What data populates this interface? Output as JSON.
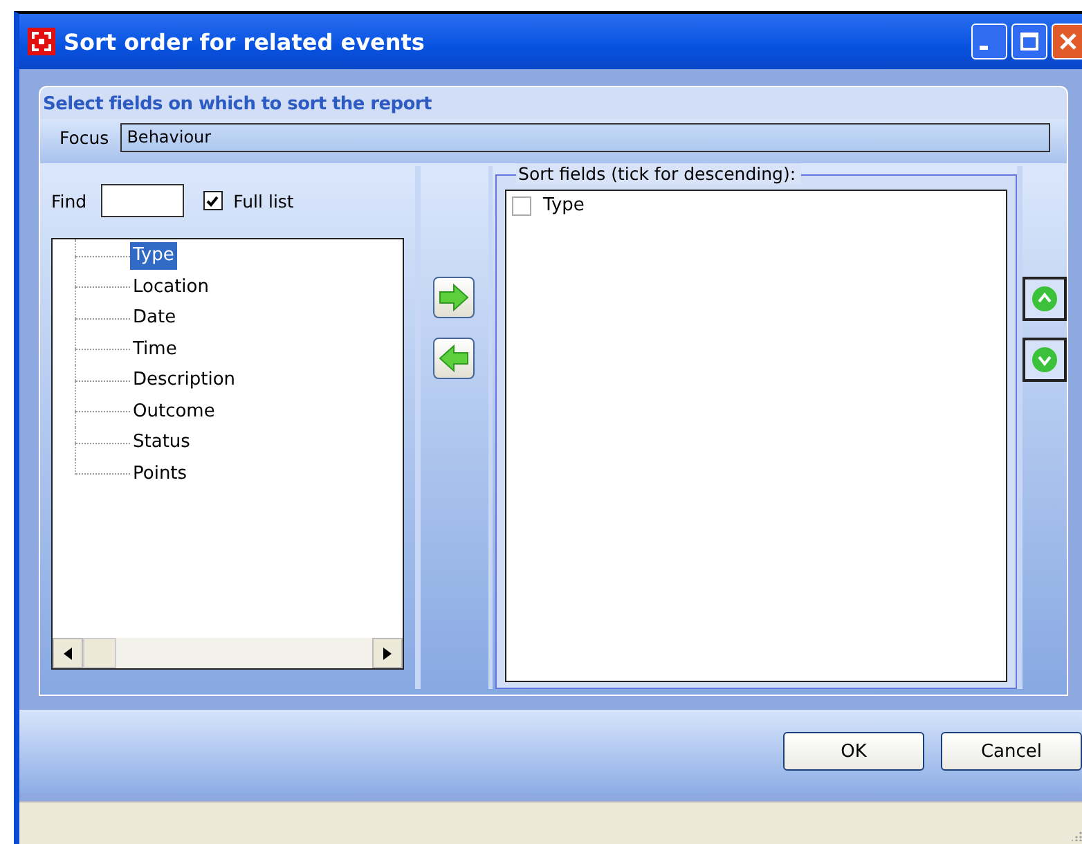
{
  "window": {
    "title": "Sort order for related events"
  },
  "header": "Select fields on which to sort the report",
  "focus": {
    "label": "Focus",
    "value": "Behaviour"
  },
  "find": {
    "label": "Find"
  },
  "full_list": {
    "label": "Full list",
    "checked": true
  },
  "fields": [
    {
      "label": "Type",
      "selected": true
    },
    {
      "label": "Location",
      "selected": false
    },
    {
      "label": "Date",
      "selected": false
    },
    {
      "label": "Time",
      "selected": false
    },
    {
      "label": "Description",
      "selected": false
    },
    {
      "label": "Outcome",
      "selected": false
    },
    {
      "label": "Status",
      "selected": false
    },
    {
      "label": "Points",
      "selected": false
    }
  ],
  "sort_fields": {
    "title": "Sort fields (tick for descending):",
    "items": [
      {
        "label": "Type",
        "checked": false
      }
    ]
  },
  "buttons": [
    "OK",
    "Cancel"
  ]
}
